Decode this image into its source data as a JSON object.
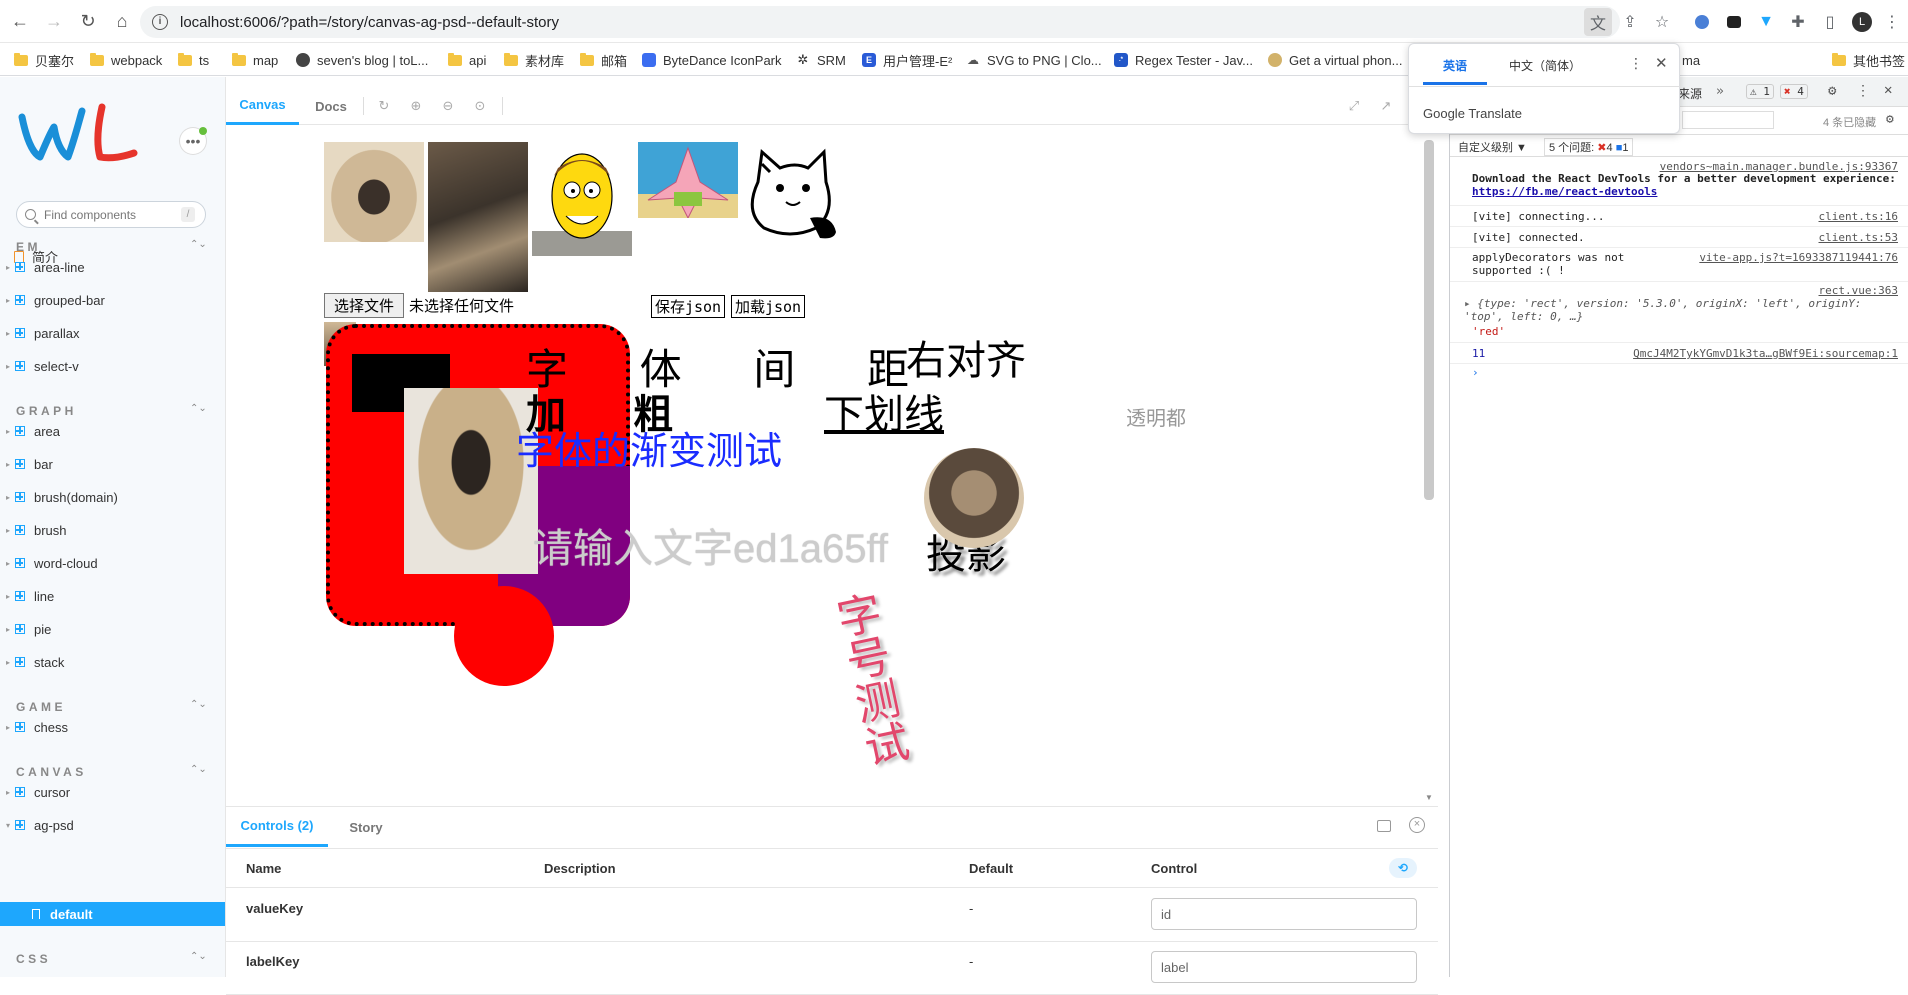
{
  "browser": {
    "url": "localhost:6006/?path=/story/canvas-ag-psd--default-story",
    "bookmarks": [
      "贝塞尔",
      "webpack",
      "ts",
      "map",
      "seven's blog | toL...",
      "api",
      "素材库",
      "邮箱",
      "ByteDance IconPark",
      "SRM",
      "用户管理-E²",
      "SVG to PNG | Clo...",
      "Regex Tester - Jav...",
      "Get a virtual phon...",
      "ma",
      "其他书签"
    ],
    "profile_initial": "L"
  },
  "translate": {
    "tab_en": "英语",
    "tab_zh": "中文（简体）",
    "footer_brand": "Google",
    "footer_text": "Translate"
  },
  "sidebar": {
    "search_placeholder": "Find components",
    "search_shortcut": "/",
    "intro": "简介",
    "sections": [
      {
        "title": "EM",
        "items": [
          "area-line",
          "grouped-bar",
          "parallax",
          "select-v"
        ]
      },
      {
        "title": "GRAPH",
        "items": [
          "area",
          "bar",
          "brush(domain)",
          "brush",
          "word-cloud",
          "line",
          "pie",
          "stack"
        ]
      },
      {
        "title": "GAME",
        "items": [
          "chess"
        ]
      },
      {
        "title": "CANVAS",
        "items": [
          "cursor",
          "ag-psd"
        ]
      },
      {
        "title": "CSS",
        "items": []
      }
    ],
    "selected_story": "default",
    "logo_text": "WL"
  },
  "preview": {
    "tabs": [
      "Canvas",
      "Docs"
    ],
    "file_button": "选择文件",
    "file_status": "未选择任何文件",
    "save_json": "保存json",
    "load_json": "加载json",
    "texts": {
      "letter_spacing": "字 体 间 距",
      "align_right": "右对齐",
      "bold": "加 粗",
      "underline": "下划线",
      "transparent": "透明都",
      "gradient": "字体的渐变测试",
      "input_placeholder": "请输入文字ed1a65ff",
      "shadow": "投影",
      "vertical": "字号测试"
    }
  },
  "addons": {
    "tabs": [
      "Controls (2)",
      "Story"
    ],
    "columns": [
      "Name",
      "Description",
      "Default",
      "Control"
    ],
    "rows": [
      {
        "name": "valueKey",
        "default": "-",
        "control": "id"
      },
      {
        "name": "labelKey",
        "default": "-",
        "control": "label"
      }
    ]
  },
  "devtools": {
    "tab_partial": "来源",
    "warnings": "1",
    "errors": "4",
    "filter_level": "自定义级别 ▼",
    "issues": "5 个问题:",
    "issues_err": "4",
    "issues_info": "1",
    "hidden_count": "4 条已隐藏",
    "logs": [
      {
        "src": "vendors~main.manager.bundle.js:93367",
        "text": "Download the React DevTools for a better development experience:",
        "link": "https://fb.me/react-devtools"
      },
      {
        "src": "client.ts:16",
        "text": "[vite] connecting..."
      },
      {
        "src": "client.ts:53",
        "text": "[vite] connected."
      },
      {
        "src": "vite-app.js?t=1693387119441:76",
        "text": "applyDecorators was not supported :( !"
      },
      {
        "src": "rect.vue:363",
        "text": "{type: 'rect', version: '5.3.0', originX: 'left', originY: 'top', left: 0, …}",
        "extra": "'red'"
      },
      {
        "src": "QmcJ4M2TykYGmvD1k3ta…gBWf9Ei:sourcemap:1",
        "text": "11"
      }
    ]
  },
  "colors": {
    "accent": "#1ea7fd",
    "red": "#ff0000",
    "purple": "#800080",
    "logo_blue": "#1a8fd8",
    "logo_red": "#e6342b"
  }
}
